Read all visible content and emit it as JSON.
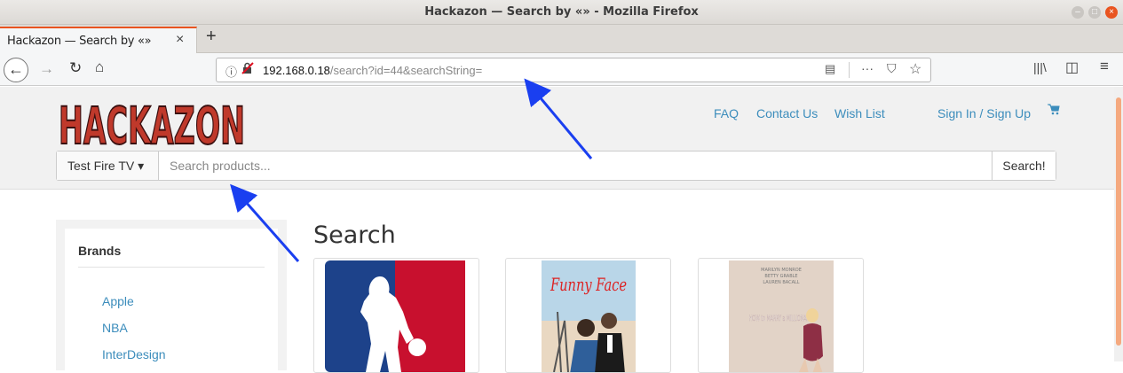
{
  "window": {
    "title": "Hackazon — Search by «» - Mozilla Firefox"
  },
  "tabs": [
    {
      "label": "Hackazon — Search by «»"
    }
  ],
  "urlbar": {
    "host": "192.168.0.18",
    "path": "/search?id=44&searchString="
  },
  "site": {
    "logo_text": "HACKAZON",
    "nav_links": [
      "FAQ",
      "Contact Us",
      "Wish List",
      "Sign In / Sign Up"
    ],
    "category": "Test Fire TV",
    "search_placeholder": "Search products...",
    "search_button": "Search!"
  },
  "sidebar": {
    "title": "Brands",
    "brands": [
      "Apple",
      "NBA",
      "InterDesign"
    ]
  },
  "main": {
    "title": "Search",
    "products": [
      {
        "image": "nba-logo"
      },
      {
        "image": "funny-face-poster",
        "poster_title": "Funny Face"
      },
      {
        "image": "how-to-marry-a-millionaire-poster",
        "poster_title": "HOW to MARRY a MILLIONAIRE",
        "poster_credits": [
          "MARILYN MONROE",
          "BETTY GRABLE",
          "LAUREN BACALL"
        ]
      }
    ]
  },
  "colors": {
    "link": "#3c8dbc",
    "logo": "#c0392b",
    "annotation_arrow": "#1a3ff0",
    "firefox_accent": "#e95420"
  }
}
